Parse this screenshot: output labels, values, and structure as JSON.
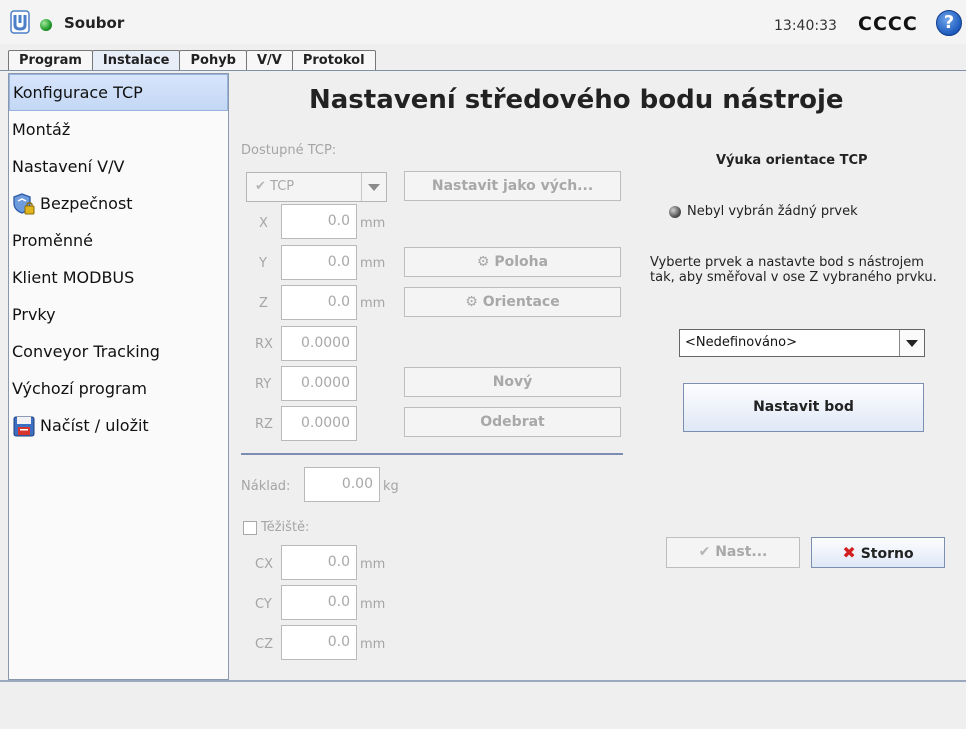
{
  "header": {
    "app_title": "Soubor",
    "clock": "13:40:33",
    "robot_name": "CCCC",
    "help_glyph": "?"
  },
  "tabs": [
    {
      "label": "Program"
    },
    {
      "label": "Instalace",
      "active": true
    },
    {
      "label": "Pohyb"
    },
    {
      "label": "V/V"
    },
    {
      "label": "Protokol"
    }
  ],
  "sidebar": {
    "items": [
      {
        "label": "Konfigurace TCP",
        "selected": true
      },
      {
        "label": "Montáž"
      },
      {
        "label": "Nastavení V/V"
      },
      {
        "label": "Bezpečnost",
        "icon": "shield-lock-icon"
      },
      {
        "label": "Proměnné"
      },
      {
        "label": "Klient MODBUS"
      },
      {
        "label": "Prvky"
      },
      {
        "label": "Conveyor Tracking"
      },
      {
        "label": "Výchozí program"
      },
      {
        "label": "Načíst / uložit",
        "icon": "floppy-disk-icon"
      }
    ]
  },
  "main": {
    "title": "Nastavení středového bodu nástroje",
    "available_tcp_label": "Dostupné TCP:",
    "tcp_combo_value": "TCP",
    "set_default_button": "Nastavit jako vých...",
    "fields": {
      "x": {
        "label": "X",
        "value": "0.0",
        "unit": "mm"
      },
      "y": {
        "label": "Y",
        "value": "0.0",
        "unit": "mm"
      },
      "z": {
        "label": "Z",
        "value": "0.0",
        "unit": "mm"
      },
      "rx": {
        "label": "RX",
        "value": "0.0000"
      },
      "ry": {
        "label": "RY",
        "value": "0.0000"
      },
      "rz": {
        "label": "RZ",
        "value": "0.0000"
      }
    },
    "position_button": "Poloha",
    "orientation_button": "Orientace",
    "new_button": "Nový",
    "remove_button": "Odebrat",
    "payload": {
      "label": "Náklad:",
      "value": "0.00",
      "unit": "kg"
    },
    "cog": {
      "label": "Těžiště:",
      "cx": {
        "label": "CX",
        "value": "0.0",
        "unit": "mm"
      },
      "cy": {
        "label": "CY",
        "value": "0.0",
        "unit": "mm"
      },
      "cz": {
        "label": "CZ",
        "value": "0.0",
        "unit": "mm"
      }
    }
  },
  "teach": {
    "title": "Výuka orientace TCP",
    "feature_status": "Nebyl vybrán žádný prvek",
    "instructions": "Vyberte prvek a nastavte bod s nástrojem tak, aby směřoval v ose Z vybraného prvku.",
    "feature_select_value": "<Nedefinováno>",
    "set_point_button": "Nastavit bod",
    "apply_button": "Nast...",
    "cancel_button": "Storno"
  },
  "colors": {
    "accent": "#2f5fb3",
    "cancel_red": "#d21f1f",
    "status_green": "#1f9a2a"
  }
}
